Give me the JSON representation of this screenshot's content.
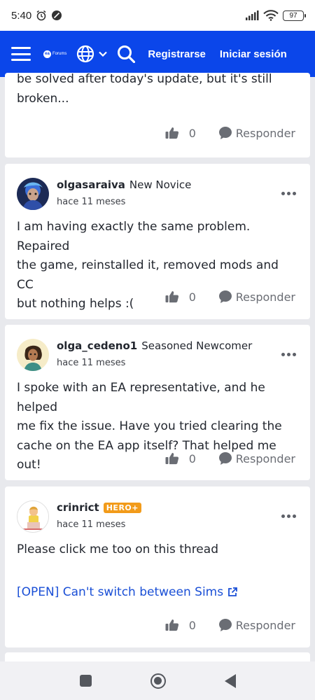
{
  "status_bar": {
    "time": "5:40",
    "battery": "97"
  },
  "header": {
    "logo_text": "Forums",
    "register_label": "Registrarse",
    "login_label": "Iniciar sesión"
  },
  "posts": [
    {
      "text_lines": [
        "be solved after today's update, but it's still",
        "broken..."
      ],
      "likes": "0",
      "reply_label": "Responder"
    },
    {
      "author": "olgasaraiva",
      "rank": "New Novice",
      "time": "hace 11 meses",
      "text_lines": [
        "I am having exactly the same problem. Repaired",
        "the game, reinstalled it, removed mods and CC",
        "but nothing helps :("
      ],
      "likes": "0",
      "reply_label": "Responder"
    },
    {
      "author": "olga_cedeno1",
      "rank": "Seasoned Newcomer",
      "time": "hace 11 meses",
      "text_lines": [
        "I spoke with an EA representative, and he helped",
        "me fix the issue. Have you tried clearing the",
        "cache on the EA app itself? That helped me out!"
      ],
      "likes": "0",
      "reply_label": "Responder"
    },
    {
      "author": "crinrict",
      "badge": "HERO+",
      "time": "hace 11 meses",
      "text_lines": [
        "Please click me too on this thread"
      ],
      "link_text": "[OPEN] Can't switch between Sims",
      "likes": "0",
      "reply_label": "Responder"
    }
  ],
  "colors": {
    "header_bg": "#0b46ea",
    "badge": "#f29b1a",
    "link": "#1a4fd6"
  }
}
